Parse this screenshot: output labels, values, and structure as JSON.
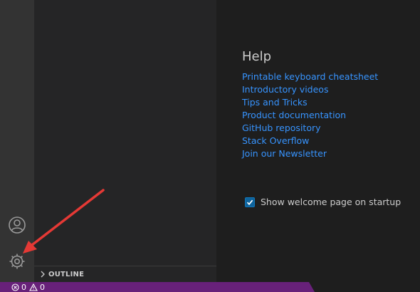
{
  "activity_bar": {
    "icons": [
      "accounts-icon",
      "manage-gear-icon"
    ]
  },
  "sidebar": {
    "outline_label": "OUTLINE"
  },
  "welcome": {
    "help_title": "Help",
    "help_links": [
      "Printable keyboard cheatsheet",
      "Introductory videos",
      "Tips and Tricks",
      "Product documentation",
      "GitHub repository",
      "Stack Overflow",
      "Join our Newsletter"
    ],
    "show_on_startup_label": "Show welcome page on startup",
    "show_on_startup_checked": true
  },
  "status_bar": {
    "errors_count": "0",
    "warnings_count": "0",
    "color": "#68217a"
  },
  "annotation": {
    "arrow_color": "#e53935"
  }
}
